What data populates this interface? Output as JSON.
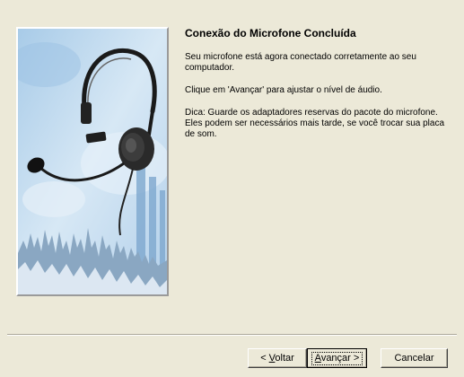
{
  "wizard": {
    "title": "Conexão do Microfone Concluída",
    "paragraph_1": "Seu microfone está agora conectado corretamente ao seu computador.",
    "paragraph_2": "Clique em 'Avançar' para ajustar o nível de áudio.",
    "paragraph_3": "Dica:  Guarde os adaptadores reservas do pacote do microfone. Eles podem ser necessários mais tarde, se você trocar sua placa de som.",
    "image_icon": "headset-microphone"
  },
  "buttons": {
    "back_prefix": "< ",
    "back_mnemonic": "V",
    "back_rest": "oltar",
    "next_mnemonic": "A",
    "next_rest": "vançar >",
    "cancel_label": "Cancelar"
  },
  "colors": {
    "dialog_bg": "#ece9d8",
    "image_bg": "#c6ddef",
    "wave_color": "#7f9bb7"
  }
}
